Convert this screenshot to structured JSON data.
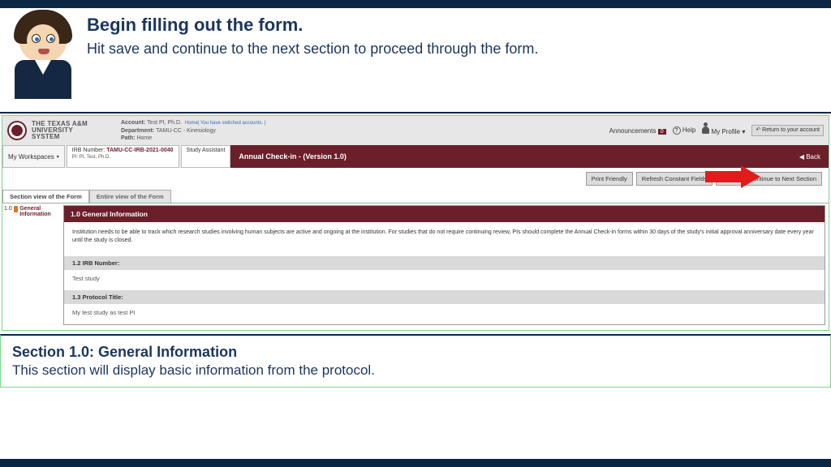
{
  "instruction": {
    "title": "Begin filling out the form.",
    "body": "Hit save and continue to the next section to proceed through the form."
  },
  "header": {
    "logo_line1": "THE TEXAS A&M",
    "logo_line2": "UNIVERSITY SYSTEM",
    "account_label": "Account:",
    "account_value": "Test PI, Ph.D.",
    "account_links": "Home| You have switched accounts. |",
    "dept_label": "Department:",
    "dept_value": "TAMU-CC - Kinesiology",
    "path_label": "Path:",
    "path_value": "Home",
    "announcements": "Announcements",
    "announcements_count": "0",
    "help": "Help",
    "profile": "My Profile",
    "return": "Return to your account"
  },
  "tabs": {
    "workspaces": "My Workspaces",
    "irb_label": "IRB Number:",
    "irb_number": "TAMU-CC-IRB-2021-0040",
    "irb_sub": "PI:   PI, Test, Ph.D.",
    "assistant": "Study Assistant",
    "bar_title": "Annual Check-in - (Version 1.0)",
    "back": "◀ Back"
  },
  "actions": {
    "print": "Print Friendly",
    "refresh": "Refresh Constant Fields",
    "save_next": "Save and Continue to Next Section"
  },
  "view_tabs": {
    "section": "Section view of the Form",
    "entire": "Entire view of the Form"
  },
  "sidenav": {
    "item1_num": "1.0",
    "item1_label": "General Information"
  },
  "form": {
    "section_header": "1.0   General Information",
    "description": "Institution needs to be able to track which research studies involving human subjects are active and ongoing at the institution. For studies that do not require continuing review, PIs should complete the Annual Check-in forms within 30 days of the study's initial approval anniversary date every year until the study is closed.",
    "f12_label": "1.2   IRB Number:",
    "f12_value": "Test study",
    "f13_label": "1.3   Protocol Title:",
    "f13_value": "My test study as test PI"
  },
  "footer": {
    "title": "Section 1.0: General Information",
    "body": "This section will display basic information from the protocol."
  }
}
